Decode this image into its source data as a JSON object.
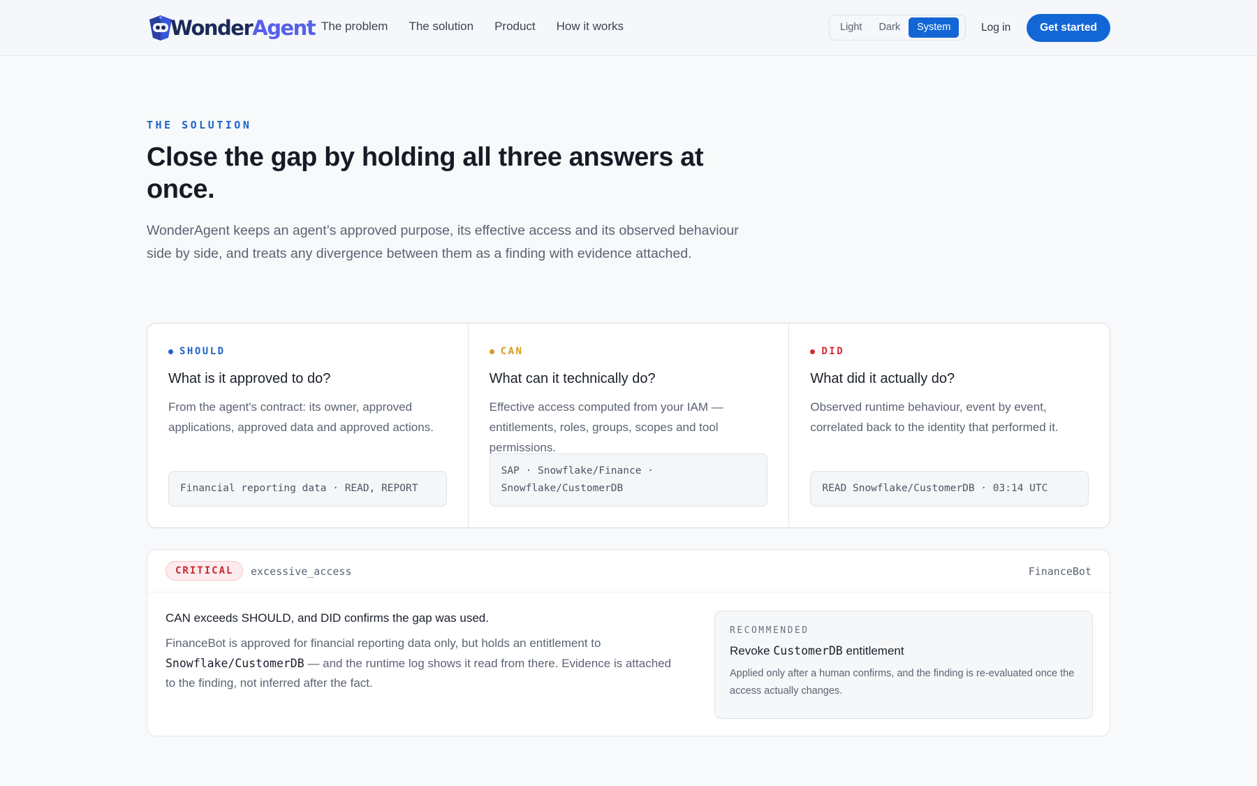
{
  "brand": {
    "name_part1": "Wonder",
    "name_part2": "Agent"
  },
  "nav": {
    "items": [
      {
        "label": "The problem"
      },
      {
        "label": "The solution"
      },
      {
        "label": "Product"
      },
      {
        "label": "How it works"
      }
    ]
  },
  "theme_toggle": {
    "options": [
      "Light",
      "Dark",
      "System"
    ],
    "selected": "System"
  },
  "header": {
    "login_label": "Log in",
    "cta_label": "Get started"
  },
  "hero": {
    "eyebrow": "THE SOLUTION",
    "title": "Close the gap by holding all three answers at once.",
    "lead": "WonderAgent keeps an agent’s approved purpose, its effective access and its observed behaviour side by side, and treats any divergence between them as a finding with evidence attached."
  },
  "cards": [
    {
      "tag": "SHOULD",
      "color": "#1f64c8",
      "heading": "What is it approved to do?",
      "body": "From the agent's contract: its owner, approved applications, approved data and approved actions.",
      "chip": "Financial reporting data · READ, REPORT"
    },
    {
      "tag": "CAN",
      "color": "#d69a1e",
      "heading": "What can it technically do?",
      "body": "Effective access computed from your IAM — entitlements, roles, groups, scopes and tool permissions.",
      "chip": "SAP · Snowflake/Finance · Snowflake/CustomerDB"
    },
    {
      "tag": "DID",
      "color": "#d12b34",
      "heading": "What did it actually do?",
      "body": "Observed runtime behaviour, event by event, correlated back to the identity that performed it.",
      "chip": "READ Snowflake/CustomerDB · 03:14 UTC"
    }
  ],
  "finding": {
    "severity": "CRITICAL",
    "type": "excessive_access",
    "agent": "FinanceBot",
    "heading": "CAN exceeds SHOULD, and DID confirms the gap was used.",
    "body_part1": "FinanceBot is approved for financial reporting data only, but holds an entitlement to ",
    "body_code": "Snowflake/CustomerDB",
    "body_part2": " — and the runtime log shows it read from there. Evidence is attached to the finding, not inferred after the fact.",
    "recommended": {
      "tag": "RECOMMENDED",
      "title_part1": "Revoke ",
      "title_code": "CustomerDB",
      "title_part2": " entitlement",
      "body": "Applied only after a human confirms, and the finding is re-evaluated once the access actually changes."
    }
  }
}
